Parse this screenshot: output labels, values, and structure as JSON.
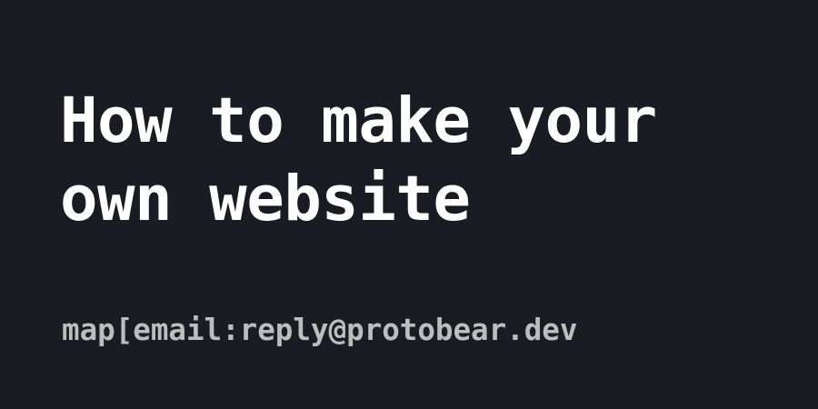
{
  "card": {
    "title": "How to make your own website",
    "meta": "map[email:reply@protobear.dev"
  },
  "colors": {
    "background": "#1b1b23",
    "title": "#ffffff",
    "meta": "#bdbdbd"
  }
}
